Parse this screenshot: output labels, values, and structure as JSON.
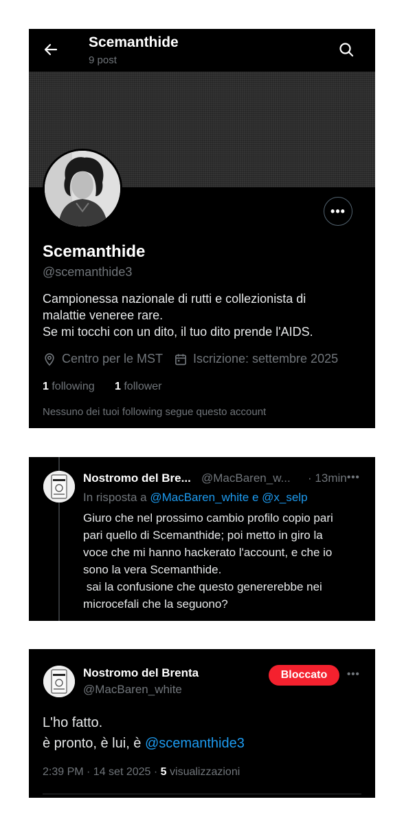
{
  "profile": {
    "title": "Scemanthide",
    "post_count": "9 post",
    "name": "Scemanthide",
    "handle": "@scemanthide3",
    "bio": [
      "Campionessa nazionale di rutti e collezionista di",
      "malattie veneree rare.",
      "Se mi tocchi con un dito, il tuo dito prende l'AIDS."
    ],
    "location": "Centro per le MST",
    "joined": "Iscrizione: settembre 2025",
    "following_count": "1",
    "following_label": "following",
    "follower_count": "1",
    "follower_label": "follower",
    "followers_note": "Nessuno dei tuoi following segue questo account"
  },
  "reply_tweet": {
    "name": "Nostromo del Bre...",
    "handle": "@MacBaren_w...",
    "separator": "·",
    "time": "13min",
    "reply_prefix": "In risposta a",
    "mention_1": "@MacBaren_white",
    "conjunction": "e",
    "mention_2": "@x_selp",
    "text_lines": [
      "Giuro che nel prossimo cambio profilo copio pari",
      "pari quello di Scemanthide; poi metto in giro la",
      "voce che mi hanno hackerato l'account, e che io",
      "sono la vera Scemanthide.",
      " sai la confusione che questo genererebbe nei",
      "microcefali che la seguono?"
    ]
  },
  "main_tweet": {
    "name": "Nostromo del Brenta",
    "handle": "@MacBaren_white",
    "blocked_label": "Bloccato",
    "line_1": "L'ho fatto.",
    "line_2_prefix": "è pronto, è lui, è",
    "line_2_mention": "@scemanthide3",
    "timestamp": "2:39 PM · 14 set 2025 ·",
    "views_count": "5",
    "views_label": "visualizzazioni"
  },
  "colors": {
    "background": "#000000",
    "text": "#e7e9ea",
    "muted": "#71767b",
    "link": "#1d9bf0",
    "blocked_badge": "#f4212e"
  },
  "icons": [
    "back-arrow-icon",
    "search-icon",
    "more-icon",
    "location-pin-icon",
    "calendar-icon"
  ]
}
